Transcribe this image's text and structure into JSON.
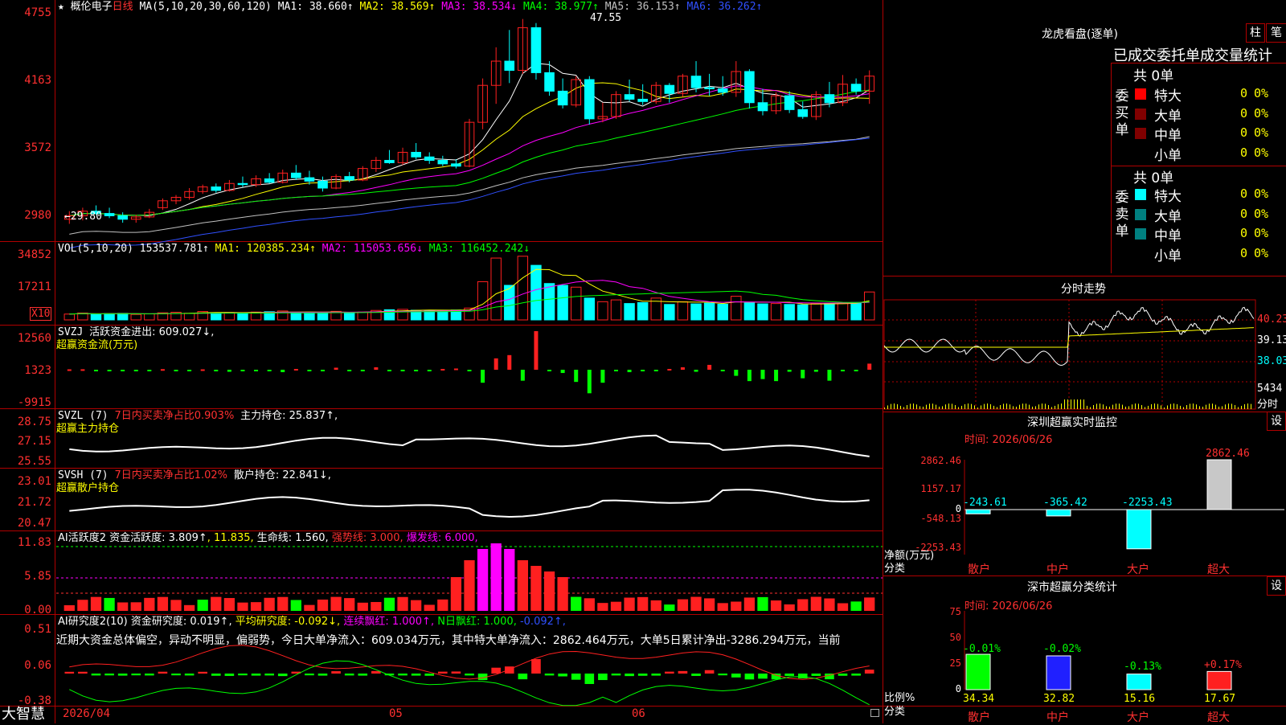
{
  "colors": {
    "up": "#ff2020",
    "down": "#00ffff",
    "grid": "#b00000",
    "ma1": "#ffffff",
    "ma2": "#ffff00",
    "ma3": "#ff00ff",
    "ma4": "#00ff00",
    "ma5": "#c0c0c0",
    "ma6": "#3050ff"
  },
  "header": {
    "star": "★",
    "stock_name": "概伦电子",
    "period": "日线",
    "ma_label": "MA(5,10,20,30,60,120)",
    "ma1": "MA1: 38.660↑",
    "ma2": "MA2: 38.569↑",
    "ma3": "MA3: 38.534↓",
    "ma4": "MA4: 38.977↑",
    "ma5": "MA5: 36.153↑",
    "ma6": "MA6: 36.262↑"
  },
  "price_panel": {
    "ticks": [
      "4755",
      "4163",
      "3572",
      "2980"
    ],
    "high_label": "47.55",
    "low_label": "←29.80"
  },
  "vol_panel": {
    "formula": "VOL(5,10,20)",
    "value": "153537.781↑",
    "ma1": "MA1: 120385.234↑",
    "ma2": "MA2: 115053.656↓",
    "ma3": "MA3: 116452.242↓",
    "ticks": [
      "34852",
      "17211"
    ],
    "unit": "X10"
  },
  "svzj_panel": {
    "name": "SVZJ",
    "label": "活跃资金进出: 609.027↓,",
    "title": "超赢资金流(万元)",
    "ticks": [
      "12560",
      "1323",
      "-9915"
    ]
  },
  "svzl_panel": {
    "name": "SVZL (7)",
    "label1": "7日内买卖净占比0.903%",
    "label2": "主力持仓: 25.837↑,",
    "title": "超赢主力持仓",
    "ticks": [
      "28.75",
      "27.15",
      "25.55"
    ]
  },
  "svsh_panel": {
    "name": "SVSH (7)",
    "label1": "7日内买卖净占比1.02%",
    "label2": "散户持仓: 22.841↓,",
    "title": "超赢散户持仓",
    "ticks": [
      "23.01",
      "21.72",
      "20.47"
    ]
  },
  "ai1_panel": {
    "name": "AI活跃度2",
    "l1": "资金活跃度: 3.809↑",
    "l2": ", 11.835,",
    "l3": "生命线: 1.560,",
    "l4": "强势线: 3.000,",
    "l5": "爆发线: 6.000,",
    "ticks": [
      "11.83",
      "5.85",
      "0.00"
    ]
  },
  "ai2_panel": {
    "name": "AI研究度2(10)",
    "l1": "资金研究度: 0.019↑,",
    "l2": "平均研究度: -0.092↓,",
    "l3": "连续飘红: 1.000↑,",
    "l4": "N日飘红: 1.000,",
    "l5": "-0.092↑,",
    "summary": "近期大资金总体偏空，异动不明显，偏弱势，今日大单净流入：609.034万元，其中特大单净流入：2862.464万元，大单5日累计净出-3286.294万元，当前",
    "ticks": [
      "0.51",
      "0.06",
      "-0.38"
    ]
  },
  "bottom_bar": {
    "brand": "大智慧",
    "dates": [
      "2026/04",
      "05",
      "06"
    ]
  },
  "longhu": {
    "title": "龙虎看盘(逐单)",
    "btn1": "柱",
    "btn2": "笔",
    "subtitle": "已成交委托单成交量统计",
    "buy_label": "委买单",
    "sell_label": "委卖单",
    "buy_total": "共 0单",
    "sell_total": "共 0单",
    "buy_rows": [
      {
        "name": "特大",
        "count": "0",
        "pct": "0%",
        "color": "#ff0000"
      },
      {
        "name": "大单",
        "count": "0",
        "pct": "0%",
        "color": "#800000"
      },
      {
        "name": "中单",
        "count": "0",
        "pct": "0%",
        "color": "#800000"
      },
      {
        "name": "小单",
        "count": "0",
        "pct": "0%",
        "color": ""
      }
    ],
    "sell_rows": [
      {
        "name": "特大",
        "count": "0",
        "pct": "0%",
        "color": "#00ffff"
      },
      {
        "name": "大单",
        "count": "0",
        "pct": "0%",
        "color": "#008080"
      },
      {
        "name": "中单",
        "count": "0",
        "pct": "0%",
        "color": "#008080"
      },
      {
        "name": "小单",
        "count": "0",
        "pct": "0%",
        "color": ""
      }
    ]
  },
  "fenshi": {
    "title": "分时走势",
    "ticks": [
      "40.23",
      "39.13",
      "38.03"
    ],
    "vol_tick": "5434",
    "vol_label": "分时"
  },
  "sz_monitor": {
    "title": "深圳超赢实时监控",
    "btn": "设",
    "time": "时间: 2026/06/26",
    "ticks": [
      "2862.46",
      "1157.17",
      "0",
      "-548.13",
      "-2253.43"
    ],
    "ylabel": "净额(万元)",
    "xlabel": "分类",
    "categories": [
      "散户",
      "中户",
      "大户",
      "超大"
    ],
    "values": [
      "-243.61",
      "-365.42",
      "-2253.43",
      "2862.46"
    ]
  },
  "sz_class": {
    "title": "深市超赢分类统计",
    "btn": "设",
    "time": "时间: 2026/06/26",
    "ticks": [
      "75",
      "50",
      "25",
      "0"
    ],
    "ylabel": "比例%",
    "xlabel": "分类",
    "categories": [
      "散户",
      "中户",
      "大户",
      "超大"
    ],
    "values": [
      "34.34",
      "32.82",
      "15.16",
      "17.67"
    ],
    "changes": [
      "-0.01%",
      "-0.02%",
      "-0.13%",
      "+0.17%"
    ]
  },
  "chart_data": [
    {
      "type": "candlestick",
      "title": "概伦电子 日线",
      "ylim": [
        29.0,
        48.5
      ],
      "candles": [
        [
          30.2,
          30.9,
          29.8,
          30.5
        ],
        [
          30.5,
          31.2,
          30.1,
          30.9
        ],
        [
          30.9,
          31.4,
          30.6,
          30.7
        ],
        [
          30.7,
          31.2,
          30.3,
          30.5
        ],
        [
          30.5,
          30.8,
          29.9,
          30.2
        ],
        [
          30.2,
          30.6,
          29.9,
          30.4
        ],
        [
          30.4,
          31.1,
          30.3,
          30.8
        ],
        [
          31.2,
          32.0,
          31.0,
          31.8
        ],
        [
          31.8,
          32.3,
          31.5,
          32.1
        ],
        [
          32.1,
          32.9,
          31.9,
          32.6
        ],
        [
          32.6,
          33.2,
          32.4,
          33.0
        ],
        [
          33.0,
          33.3,
          32.5,
          32.7
        ],
        [
          32.7,
          33.6,
          32.6,
          33.3
        ],
        [
          33.3,
          33.9,
          33.0,
          33.2
        ],
        [
          33.2,
          34.0,
          33.0,
          33.7
        ],
        [
          33.7,
          34.2,
          33.3,
          33.4
        ],
        [
          33.4,
          34.5,
          33.3,
          34.2
        ],
        [
          34.2,
          34.9,
          33.6,
          33.8
        ],
        [
          33.8,
          34.4,
          33.2,
          33.5
        ],
        [
          33.5,
          33.9,
          32.6,
          32.9
        ],
        [
          32.9,
          34.1,
          32.8,
          33.9
        ],
        [
          33.9,
          34.3,
          33.4,
          33.6
        ],
        [
          33.6,
          34.8,
          33.5,
          34.6
        ],
        [
          34.6,
          35.6,
          34.3,
          35.3
        ],
        [
          35.3,
          36.2,
          35.0,
          35.1
        ],
        [
          35.1,
          36.4,
          34.9,
          36.0
        ],
        [
          36.0,
          36.8,
          35.4,
          35.6
        ],
        [
          35.6,
          36.0,
          35.0,
          35.3
        ],
        [
          35.3,
          35.7,
          34.8,
          35.0
        ],
        [
          35.0,
          35.4,
          34.6,
          34.8
        ],
        [
          34.8,
          38.9,
          34.7,
          38.6
        ],
        [
          38.6,
          42.4,
          38.0,
          41.8
        ],
        [
          41.8,
          45.1,
          40.2,
          43.9
        ],
        [
          43.9,
          46.6,
          42.0,
          43.1
        ],
        [
          43.1,
          47.55,
          42.8,
          46.8
        ],
        [
          46.8,
          47.2,
          42.3,
          42.9
        ],
        [
          42.9,
          43.9,
          40.9,
          41.3
        ],
        [
          41.3,
          42.4,
          39.8,
          40.1
        ],
        [
          40.1,
          42.6,
          39.9,
          42.3
        ],
        [
          42.3,
          42.6,
          38.4,
          38.9
        ],
        [
          38.9,
          40.3,
          38.6,
          39.1
        ],
        [
          39.1,
          41.3,
          38.9,
          41.0
        ],
        [
          41.0,
          42.3,
          40.4,
          40.6
        ],
        [
          40.6,
          41.9,
          40.1,
          40.4
        ],
        [
          40.4,
          42.1,
          40.2,
          41.8
        ],
        [
          41.8,
          42.0,
          40.3,
          41.1
        ],
        [
          41.1,
          42.8,
          40.8,
          42.6
        ],
        [
          42.6,
          43.9,
          41.2,
          41.6
        ],
        [
          41.6,
          42.8,
          40.9,
          41.5
        ],
        [
          41.5,
          42.6,
          40.9,
          41.2
        ],
        [
          41.2,
          43.9,
          40.8,
          43.0
        ],
        [
          43.0,
          43.2,
          39.8,
          40.3
        ],
        [
          40.3,
          41.5,
          39.2,
          39.6
        ],
        [
          39.6,
          41.2,
          39.3,
          40.9
        ],
        [
          40.9,
          41.3,
          39.4,
          39.7
        ],
        [
          39.7,
          40.4,
          38.9,
          39.1
        ],
        [
          39.1,
          41.3,
          38.8,
          41.0
        ],
        [
          41.0,
          42.1,
          39.9,
          40.3
        ],
        [
          40.3,
          42.7,
          40.0,
          41.9
        ],
        [
          41.9,
          42.4,
          41.0,
          41.3
        ],
        [
          41.3,
          43.1,
          40.2,
          42.6
        ]
      ]
    },
    {
      "type": "bar",
      "title": "VOL(5,10,20)",
      "values": [
        3200,
        3800,
        3100,
        3500,
        3600,
        3000,
        3300,
        3900,
        4200,
        3700,
        4600,
        4000,
        4100,
        3800,
        4300,
        4500,
        4900,
        4200,
        3900,
        4100,
        4700,
        4000,
        4300,
        5200,
        5600,
        5800,
        5300,
        5100,
        5000,
        5400,
        6500,
        21000,
        34000,
        19000,
        35000,
        30000,
        20000,
        19000,
        18000,
        12000,
        10000,
        11000,
        9000,
        9500,
        12000,
        8500,
        10000,
        8800,
        9200,
        8600,
        13000,
        9300,
        8800,
        9000,
        8500,
        8300,
        9100,
        9200,
        9300,
        9600,
        15353
      ]
    },
    {
      "type": "bar",
      "title": "超赢资金流(万元)",
      "values": [
        100,
        120,
        -200,
        -150,
        -300,
        -100,
        -200,
        150,
        -100,
        -200,
        100,
        -400,
        -500,
        -100,
        -300,
        -200,
        -600,
        200,
        -100,
        -300,
        500,
        -200,
        -300,
        600,
        -100,
        -200,
        -300,
        -400,
        200,
        300,
        -200,
        -3200,
        2800,
        3600,
        -2700,
        9500,
        -200,
        -800,
        -3000,
        -5800,
        -3200,
        -200,
        -600,
        -400,
        -300,
        200,
        600,
        -500,
        1200,
        -100,
        -1500,
        -2800,
        -2300,
        -2800,
        -500,
        -2100,
        -500,
        -2700,
        -400,
        -300,
        1500
      ]
    }
  ]
}
